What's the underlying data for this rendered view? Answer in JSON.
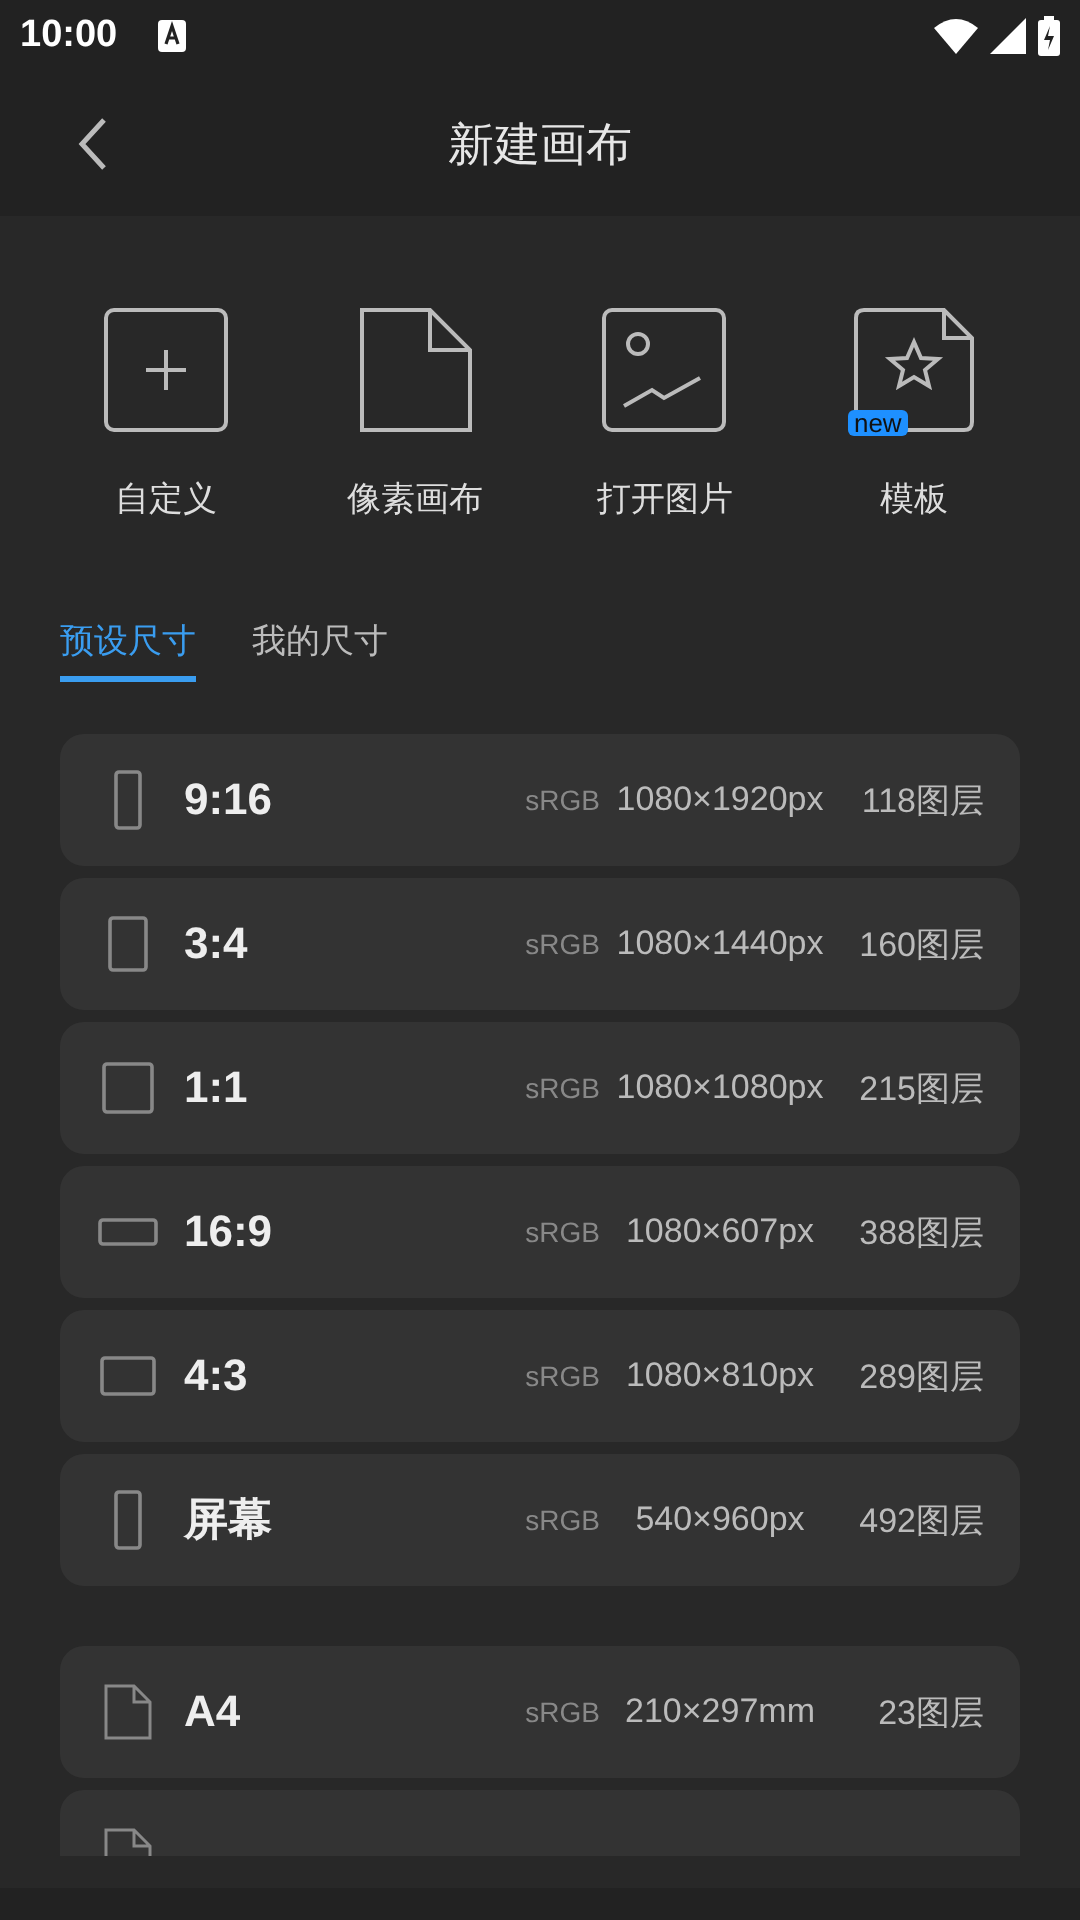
{
  "status_bar": {
    "time": "10:00"
  },
  "header": {
    "title": "新建画布"
  },
  "actions": [
    {
      "kind": "custom",
      "label": "自定义"
    },
    {
      "kind": "pixel",
      "label": "像素画布"
    },
    {
      "kind": "image",
      "label": "打开图片"
    },
    {
      "kind": "template",
      "label": "模板",
      "badge": "new"
    }
  ],
  "tabs": [
    {
      "label": "预设尺寸",
      "selected": true
    },
    {
      "label": "我的尺寸",
      "selected": false
    }
  ],
  "groups": [
    {
      "presets": [
        {
          "kind": "tall",
          "name": "9:16",
          "color_space": "sRGB",
          "size": "1080×1920px",
          "layers": "118图层"
        },
        {
          "kind": "portrait",
          "name": "3:4",
          "color_space": "sRGB",
          "size": "1080×1440px",
          "layers": "160图层"
        },
        {
          "kind": "square",
          "name": "1:1",
          "color_space": "sRGB",
          "size": "1080×1080px",
          "layers": "215图层"
        },
        {
          "kind": "wide",
          "name": "16:9",
          "color_space": "sRGB",
          "size": "1080×607px",
          "layers": "388图层"
        },
        {
          "kind": "landscape",
          "name": "4:3",
          "color_space": "sRGB",
          "size": "1080×810px",
          "layers": "289图层"
        },
        {
          "kind": "tall",
          "name": "屏幕",
          "color_space": "sRGB",
          "size": "540×960px",
          "layers": "492图层"
        }
      ]
    },
    {
      "presets": [
        {
          "kind": "page",
          "name": "A4",
          "color_space": "sRGB",
          "size": "210×297mm",
          "layers": "23图层"
        },
        {
          "kind": "page"
        }
      ]
    }
  ]
}
